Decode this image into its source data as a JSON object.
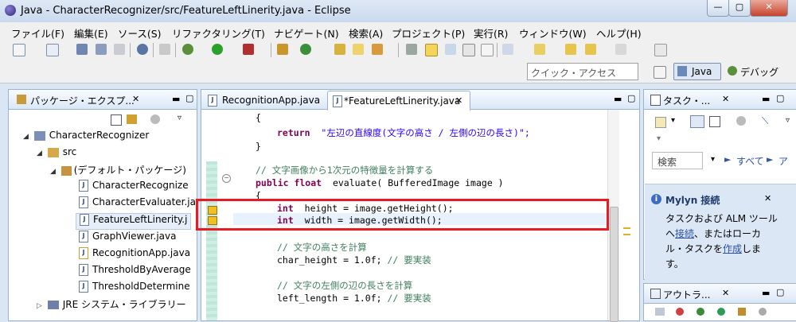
{
  "window": {
    "title": "Java - CharacterRecognizer/src/FeatureLeftLinerity.java - Eclipse"
  },
  "menu": [
    "ファイル(F)",
    "編集(E)",
    "ソース(S)",
    "リファクタリング(T)",
    "ナビゲート(N)",
    "検索(A)",
    "プロジェクト(P)",
    "実行(R)",
    "ウィンドウ(W)",
    "ヘルプ(H)"
  ],
  "toolbar": {
    "quick_access_placeholder": "クイック・アクセス",
    "perspective_java": "Java",
    "perspective_debug": "デバッグ"
  },
  "package_explorer": {
    "title": "パッケージ・エクスプ...",
    "tree": [
      "CharacterRecognizer",
      "src",
      "(デフォルト・パッケージ)",
      "CharacterRecognize",
      "CharacterEvaluater.ja",
      "FeatureLeftLinerity.j",
      "GraphViewer.java",
      "RecognitionApp.java",
      "ThresholdByAverage",
      "ThresholdDetermine",
      "JRE システム・ライブラリー"
    ]
  },
  "editor": {
    "tabs": [
      "RecognitionApp.java",
      "*FeatureLeftLinerity.java"
    ],
    "lines": [
      {
        "t": "{"
      },
      {
        "kw": "return",
        "s": "\"左辺の直線度(文字の高さ / 左側の辺の長さ)\";"
      },
      {
        "t": "}"
      },
      {
        "t": ""
      },
      {
        "c": "// 文字画像から1次元の特徴量を計算する"
      },
      {
        "kw": "public float",
        "t": "evaluate( BufferedImage image )"
      },
      {
        "t": "{"
      },
      {
        "kw": "int",
        "t": "height = image.getHeight();"
      },
      {
        "kw": "int",
        "t": "width = image.getWidth();"
      },
      {
        "t": ""
      },
      {
        "c": "// 文字の高さを計算"
      },
      {
        "t": "char_height = 1.0f;",
        "c2": "// 要実装"
      },
      {
        "t": ""
      },
      {
        "c": "// 文字の左側の辺の長さを計算"
      },
      {
        "t": "left_length = 1.0f;",
        "c2": "// 要実装"
      }
    ]
  },
  "tasks": {
    "title": "タスク・...",
    "search_label": "検索",
    "all_label": "すべて"
  },
  "mylyn": {
    "title": "Mylyn 接続",
    "text1": "タスクおよび ALM ツール",
    "text2a": "へ",
    "link1": "接続",
    "text2b": "、またはローカ",
    "text3a": "ル・タスクを",
    "link2": "作成",
    "text3b": "しま",
    "text4": "す。"
  },
  "outline": {
    "title": "アウトラ..."
  },
  "highlight_color": "#e81b23"
}
